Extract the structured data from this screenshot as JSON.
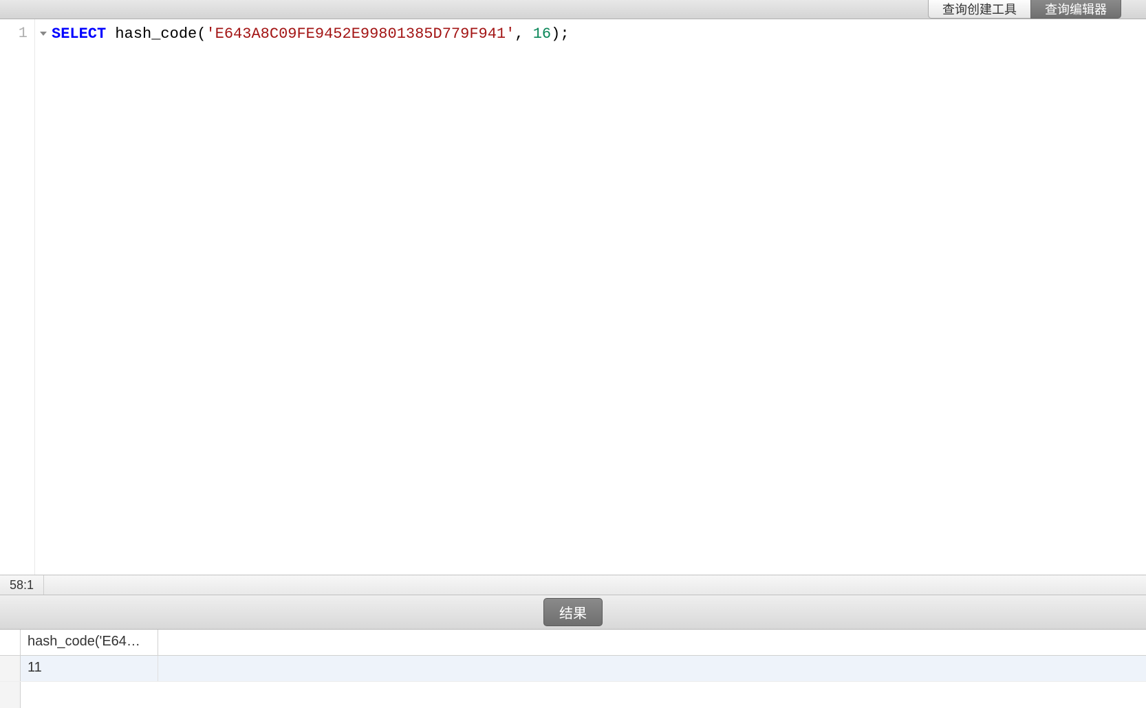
{
  "toolbar": {
    "tabs": {
      "builder": "查询创建工具",
      "editor": "查询编辑器"
    }
  },
  "editor": {
    "line_number": "1",
    "code": {
      "keyword": "SELECT",
      "func": "hash_code",
      "open_paren": "(",
      "string": "'E643A8C09FE9452E99801385D779F941'",
      "comma": ", ",
      "number": "16",
      "close": ");"
    }
  },
  "status": {
    "cursor_position": "58:1"
  },
  "result_bar": {
    "label": "结果"
  },
  "results": {
    "columns": [
      "hash_code('E64…"
    ],
    "rows": [
      [
        "11"
      ]
    ]
  }
}
